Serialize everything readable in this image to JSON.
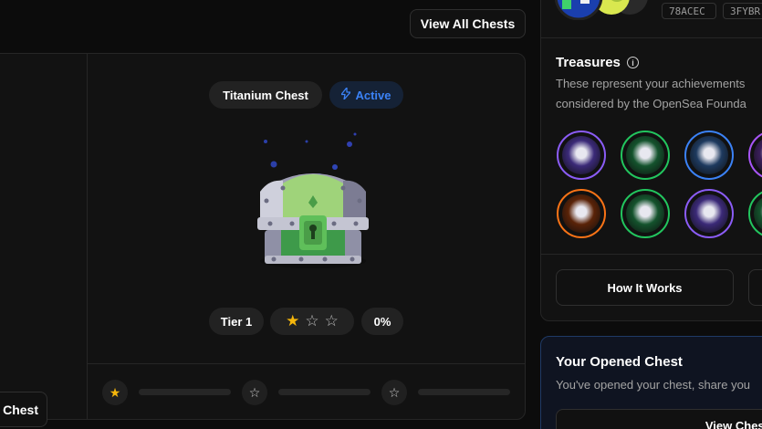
{
  "header": {
    "view_all_label": "View All Chests"
  },
  "chest": {
    "name": "Titanium Chest",
    "status": "Active",
    "tier": "Tier 1",
    "progress": "0%",
    "stars_filled": 1,
    "stars_total": 3
  },
  "track": {
    "nodes": [
      "star-filled",
      "star-outline",
      "star-outline"
    ]
  },
  "left_button": {
    "label": "t Chest"
  },
  "profile": {
    "codes": [
      "78ACEC",
      "3FYBR"
    ]
  },
  "treasures": {
    "title": "Treasures",
    "desc_line1": "These represent your achievements",
    "desc_line2": "considered by the OpenSea Founda",
    "badges": [
      {
        "ring": "#8b5cf6",
        "fill": "#3b2a78"
      },
      {
        "ring": "#22c55e",
        "fill": "#14532d"
      },
      {
        "ring": "#3b82f6",
        "fill": "#1e3a5f"
      },
      {
        "ring": "#a855f7",
        "fill": "#3b1f5c"
      },
      {
        "ring": "#f97316",
        "fill": "#5a2308"
      },
      {
        "ring": "#22c55e",
        "fill": "#14532d"
      },
      {
        "ring": "#8b5cf6",
        "fill": "#3b2a78"
      },
      {
        "ring": "#22c55e",
        "fill": "#14532d"
      }
    ]
  },
  "how_it_works": {
    "label": "How It Works"
  },
  "opened": {
    "title": "Your Opened Chest",
    "desc": "You've opened your chest, share you",
    "button_label": "View Chest"
  }
}
